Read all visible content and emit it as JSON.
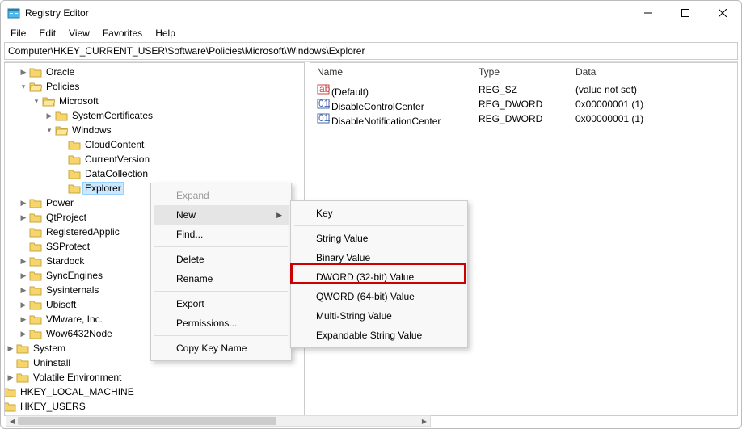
{
  "window": {
    "title": "Registry Editor"
  },
  "menu": {
    "file": "File",
    "edit": "Edit",
    "view": "View",
    "favorites": "Favorites",
    "help": "Help"
  },
  "address": "Computer\\HKEY_CURRENT_USER\\Software\\Policies\\Microsoft\\Windows\\Explorer",
  "tree": {
    "oracle": "Oracle",
    "policies": "Policies",
    "microsoft": "Microsoft",
    "systemcerts": "SystemCertificates",
    "windows": "Windows",
    "cloudcontent": "CloudContent",
    "currentversion": "CurrentVersion",
    "datacollection": "DataCollection",
    "explorer": "Explorer",
    "power": "Power",
    "qtproject": "QtProject",
    "registeredapps": "RegisteredApplic",
    "ssprotect": "SSProtect",
    "stardock": "Stardock",
    "syncengines": "SyncEngines",
    "sysinternals": "Sysinternals",
    "ubisoft": "Ubisoft",
    "vmware": "VMware, Inc.",
    "wow64": "Wow6432Node",
    "system": "System",
    "uninstall": "Uninstall",
    "volatile": "Volatile Environment",
    "hklm": "HKEY_LOCAL_MACHINE",
    "hku": "HKEY_USERS"
  },
  "columns": {
    "name": "Name",
    "type": "Type",
    "data": "Data"
  },
  "rows": [
    {
      "icon": "sz",
      "name": "(Default)",
      "type": "REG_SZ",
      "data": "(value not set)"
    },
    {
      "icon": "bin",
      "name": "DisableControlCenter",
      "type": "REG_DWORD",
      "data": "0x00000001 (1)"
    },
    {
      "icon": "bin",
      "name": "DisableNotificationCenter",
      "type": "REG_DWORD",
      "data": "0x00000001 (1)"
    }
  ],
  "ctx1": {
    "expand": "Expand",
    "new": "New",
    "find": "Find...",
    "delete": "Delete",
    "rename": "Rename",
    "export": "Export",
    "perms": "Permissions...",
    "copykey": "Copy Key Name"
  },
  "ctx2": {
    "key": "Key",
    "string": "String Value",
    "binary": "Binary Value",
    "dword": "DWORD (32-bit) Value",
    "qword": "QWORD (64-bit) Value",
    "multi": "Multi-String Value",
    "expand": "Expandable String Value"
  }
}
